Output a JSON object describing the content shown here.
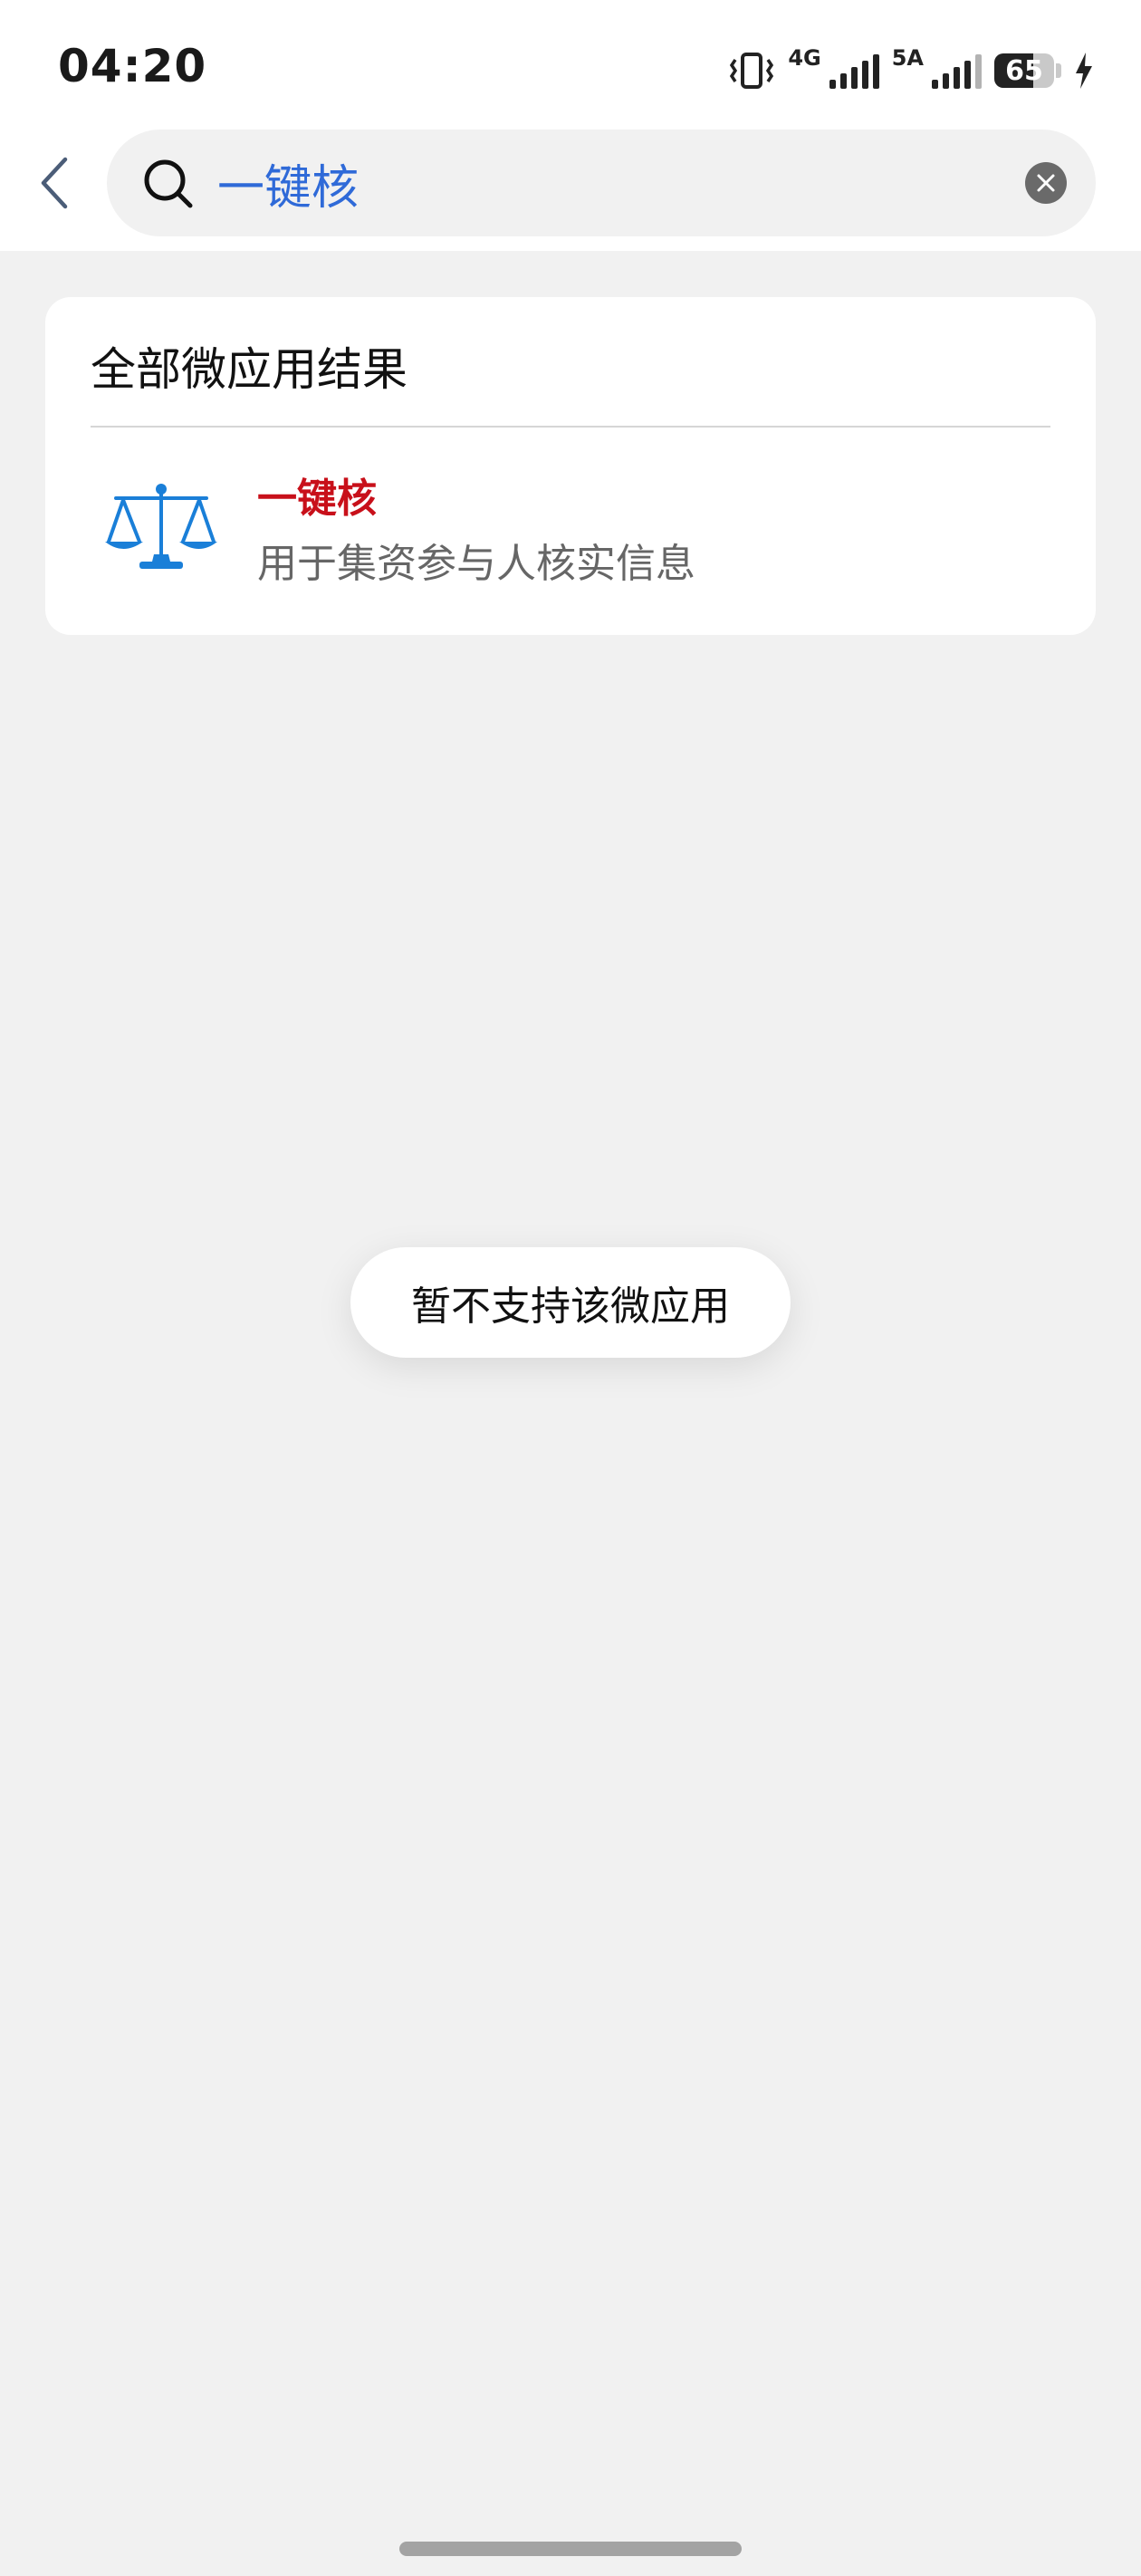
{
  "status_bar": {
    "time": "04:20",
    "network_1": "4G",
    "network_2": "5A",
    "battery_percent": "65",
    "battery_level": 0.65,
    "icons": [
      "vibrate-icon",
      "signal-icon",
      "signal-icon",
      "battery-icon",
      "charging-icon"
    ]
  },
  "search": {
    "query": "一键核",
    "icons": {
      "back": "chevron-left-icon",
      "search": "search-icon",
      "clear": "clear-icon"
    },
    "colors": {
      "query_text": "#2f6ad8"
    }
  },
  "results": {
    "section_title": "全部微应用结果",
    "items": [
      {
        "name": "一键核",
        "description": "用于集资参与人核实信息",
        "icon": "scales-icon",
        "name_color": "#c8101a"
      }
    ]
  },
  "toast": {
    "message": "暂不支持该微应用"
  },
  "colors": {
    "background": "#f1f1f1",
    "card": "#ffffff",
    "icon_blue": "#1a7fd8"
  }
}
